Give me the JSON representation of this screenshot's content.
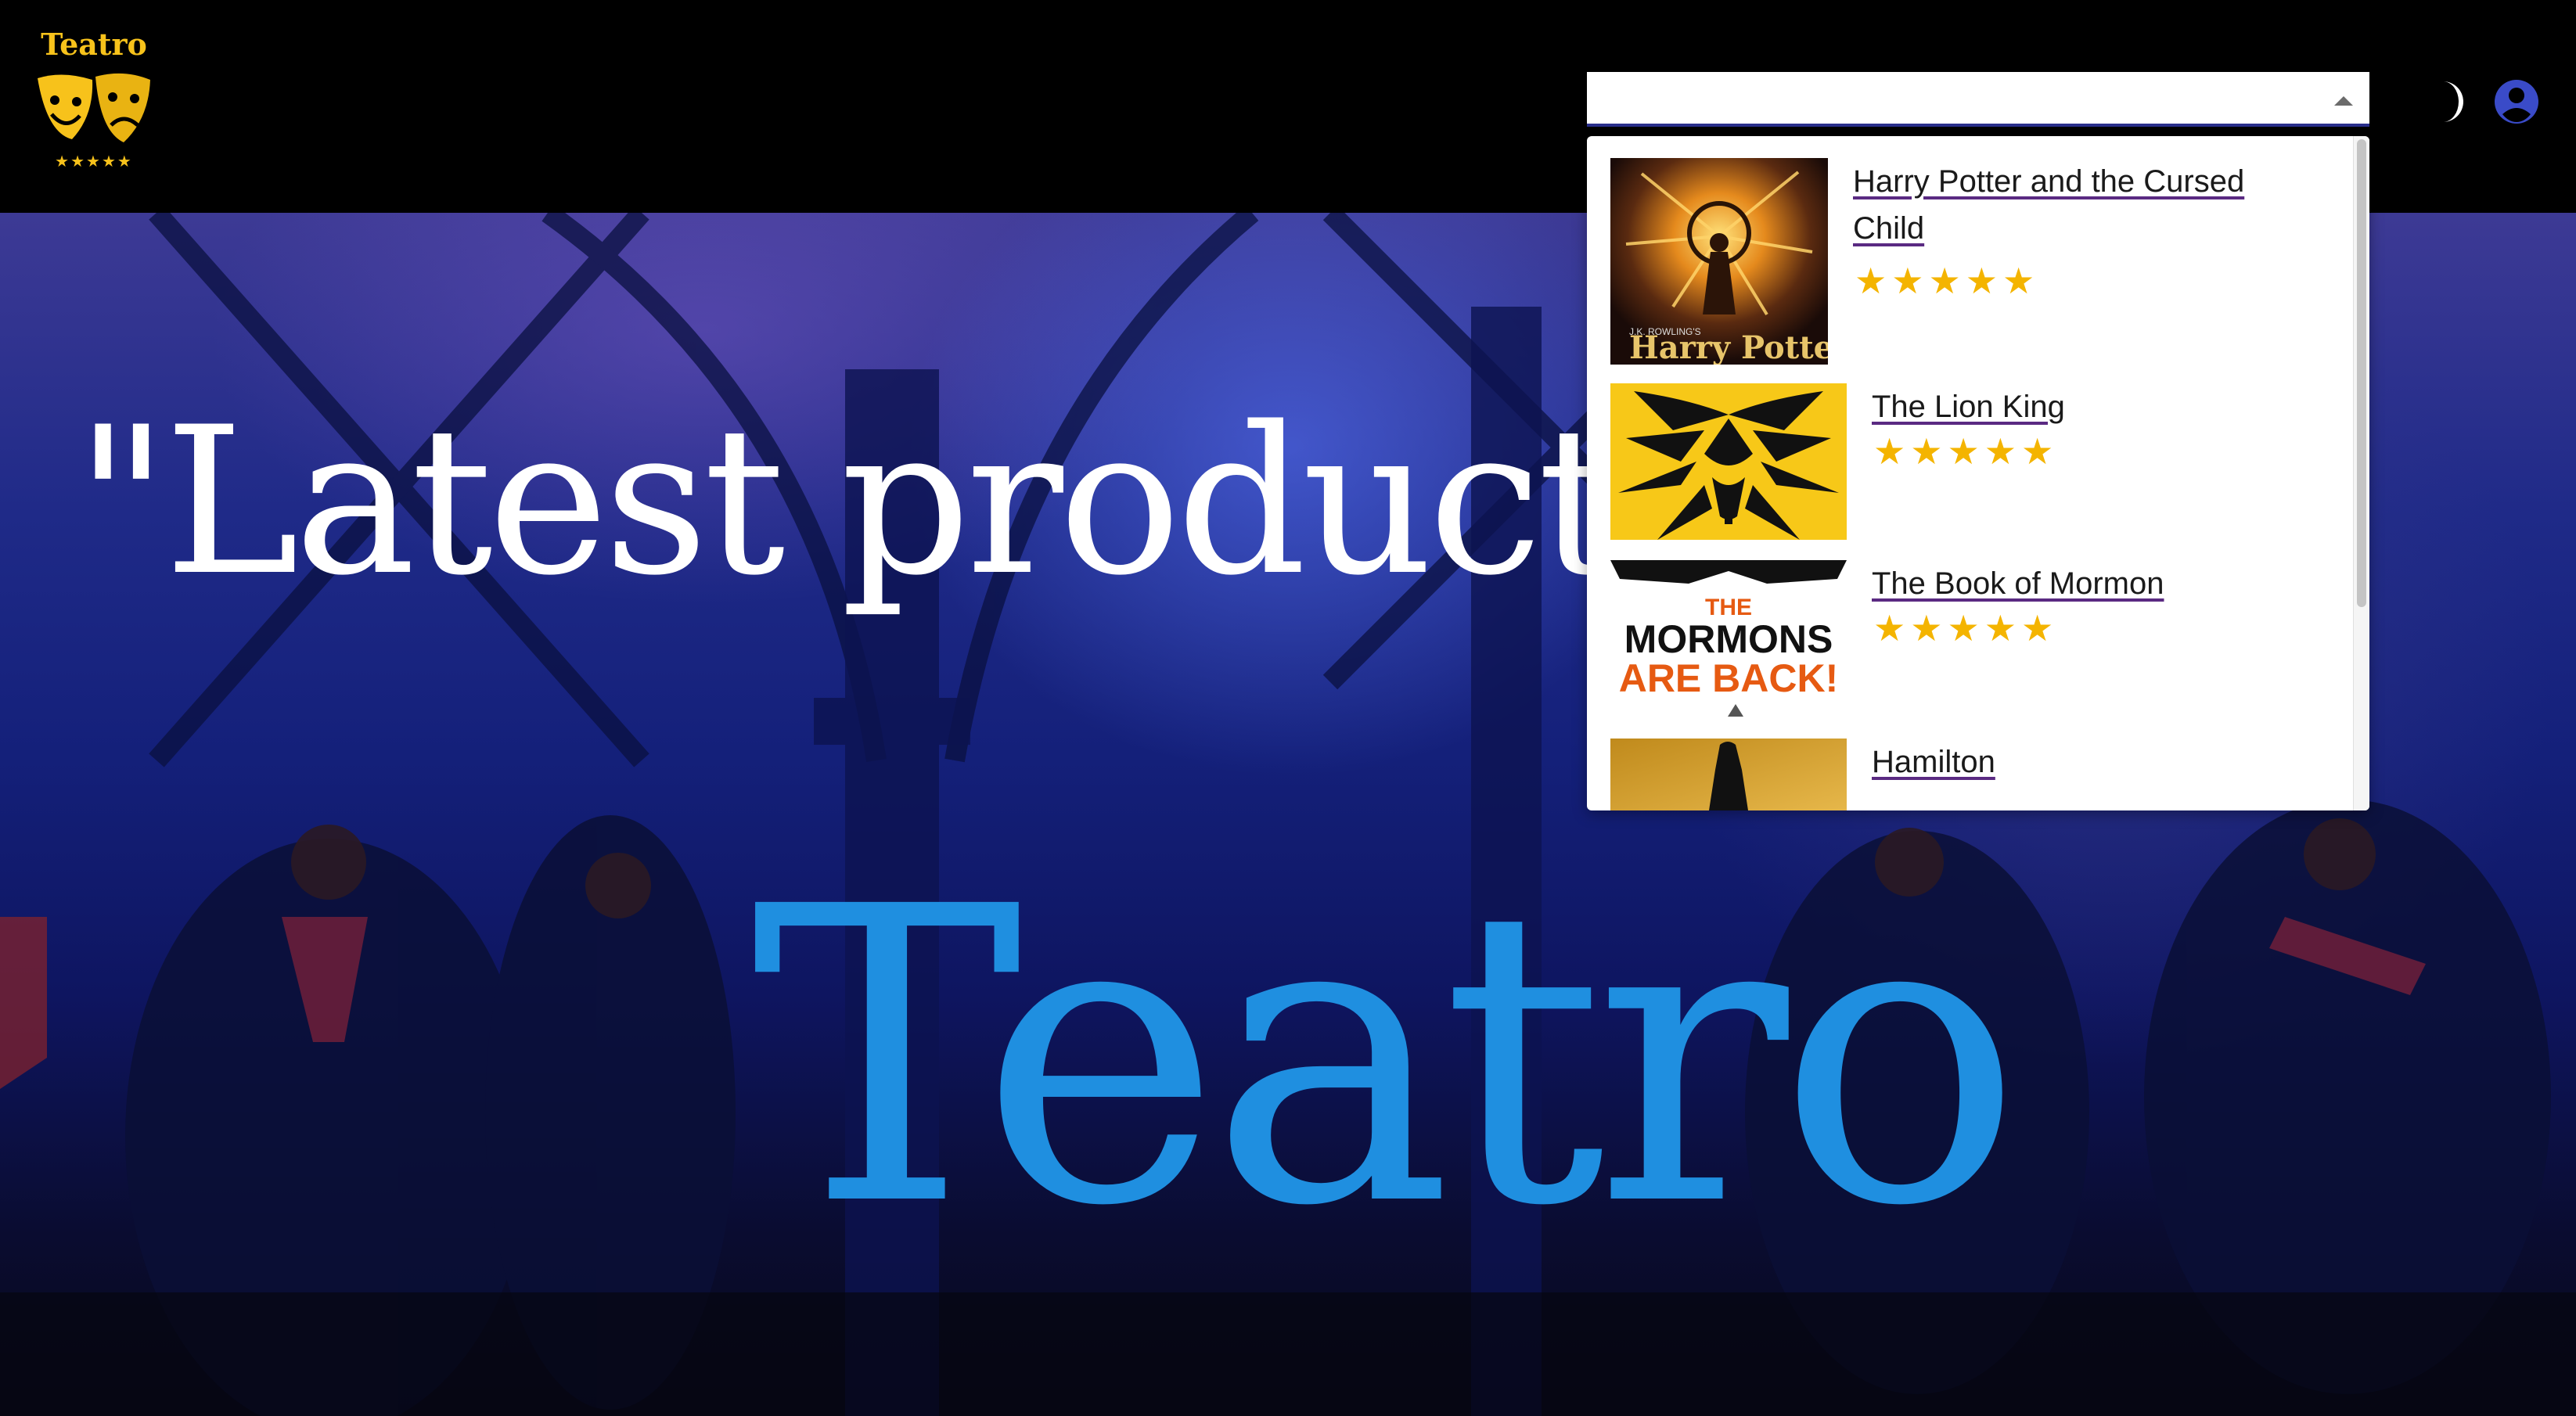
{
  "header": {
    "logo_text": "Teatro",
    "logo_stars": "★★★★★",
    "theme_icon": "moon-icon",
    "account_icon": "user-icon"
  },
  "search": {
    "value": "",
    "placeholder": ""
  },
  "results": [
    {
      "title_line1": "Harry Potter and the Cursed",
      "title_line2": "Child",
      "stars": "★★★★★",
      "rating": 5,
      "poster_text": "Harry Potter",
      "poster_sub": "J.K. ROWLING'S"
    },
    {
      "title_line1": "The Lion King",
      "title_line2": "",
      "stars": "★★★★★",
      "rating": 5
    },
    {
      "title_line1": "The Book of Mormon",
      "title_line2": "",
      "stars": "★★★★★",
      "rating": 5,
      "poster_line1": "THE",
      "poster_line2": "MORMONS",
      "poster_line3": "ARE BACK!"
    },
    {
      "title_line1": "Hamilton",
      "title_line2": "",
      "stars": "",
      "rating": null
    }
  ],
  "hero": {
    "quote": "\"Latest productio",
    "brand": "Teatro"
  },
  "colors": {
    "accent_gold": "#f7c21b",
    "brand_blue": "#1f8fe0",
    "star": "#f4b400",
    "user_icon": "#3a4bc8"
  }
}
